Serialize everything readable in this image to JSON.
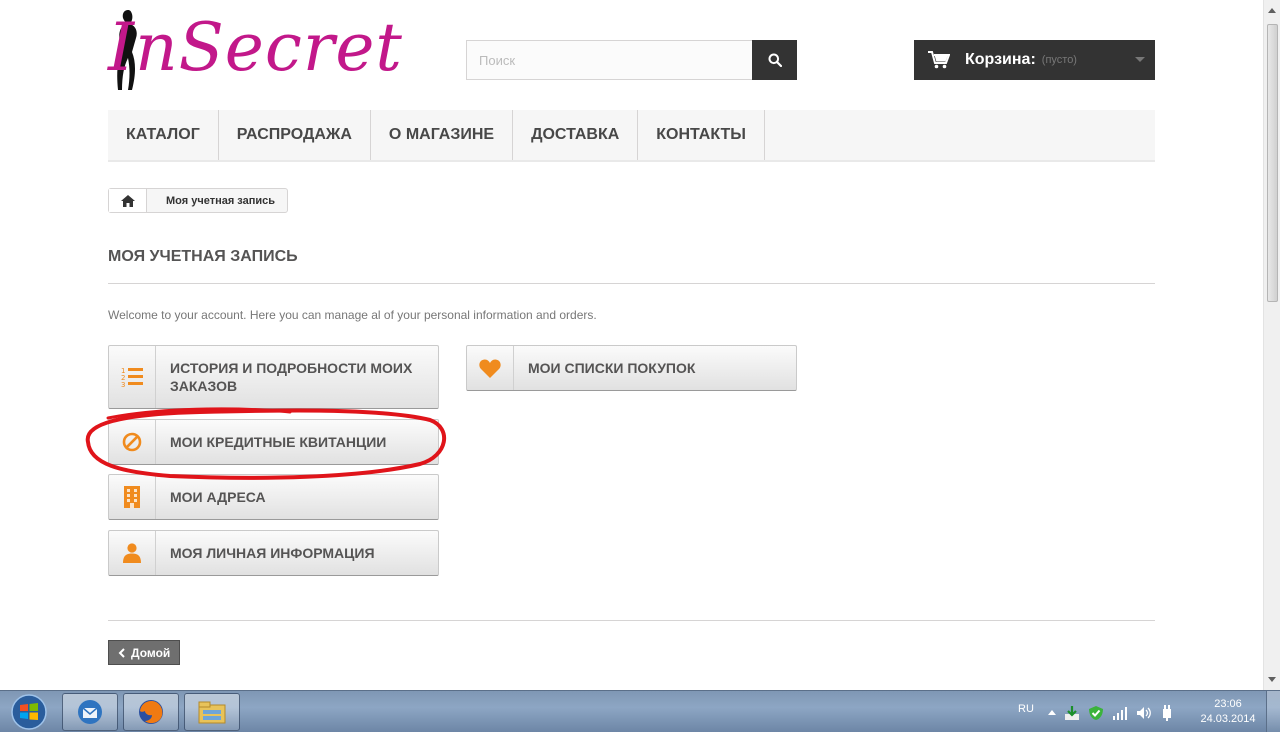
{
  "header": {
    "logo_text": "InSecret",
    "search_placeholder": "Поиск",
    "cart_title": "Корзина:",
    "cart_status": "(пусто)"
  },
  "menu": {
    "items": [
      "КАТАЛОГ",
      "РАСПРОДАЖА",
      "О МАГАЗИНЕ",
      "ДОСТАВКА",
      "КОНТАКТЫ"
    ]
  },
  "breadcrumb": {
    "current": "Моя учетная запись"
  },
  "page": {
    "title": "МОЯ УЧЕТНАЯ ЗАПИСЬ",
    "welcome": "Welcome to your account. Here you can manage al of your personal information and orders."
  },
  "account_links": {
    "order_history": "ИСТОРИЯ И ПОДРОБНОСТИ МОИХ ЗАКАЗОВ",
    "credit_slips": "МОИ КРЕДИТНЫЕ КВИТАНЦИИ",
    "addresses": "МОИ АДРЕСА",
    "personal_info": "МОЯ ЛИЧНАЯ ИНФОРМАЦИЯ",
    "wishlists": "МОИ СПИСКИ ПОКУПОК"
  },
  "footer": {
    "home_button": "Домой"
  },
  "colors": {
    "accent_orange": "#f08b1e",
    "brand_magenta": "#c2188a",
    "annotation_red": "#e0141a",
    "dark_button": "#333333"
  },
  "taskbar": {
    "language": "RU",
    "time": "23:06",
    "date": "24.03.2014",
    "apps": [
      "thunderbird-icon",
      "firefox-icon",
      "explorer-icon"
    ]
  }
}
